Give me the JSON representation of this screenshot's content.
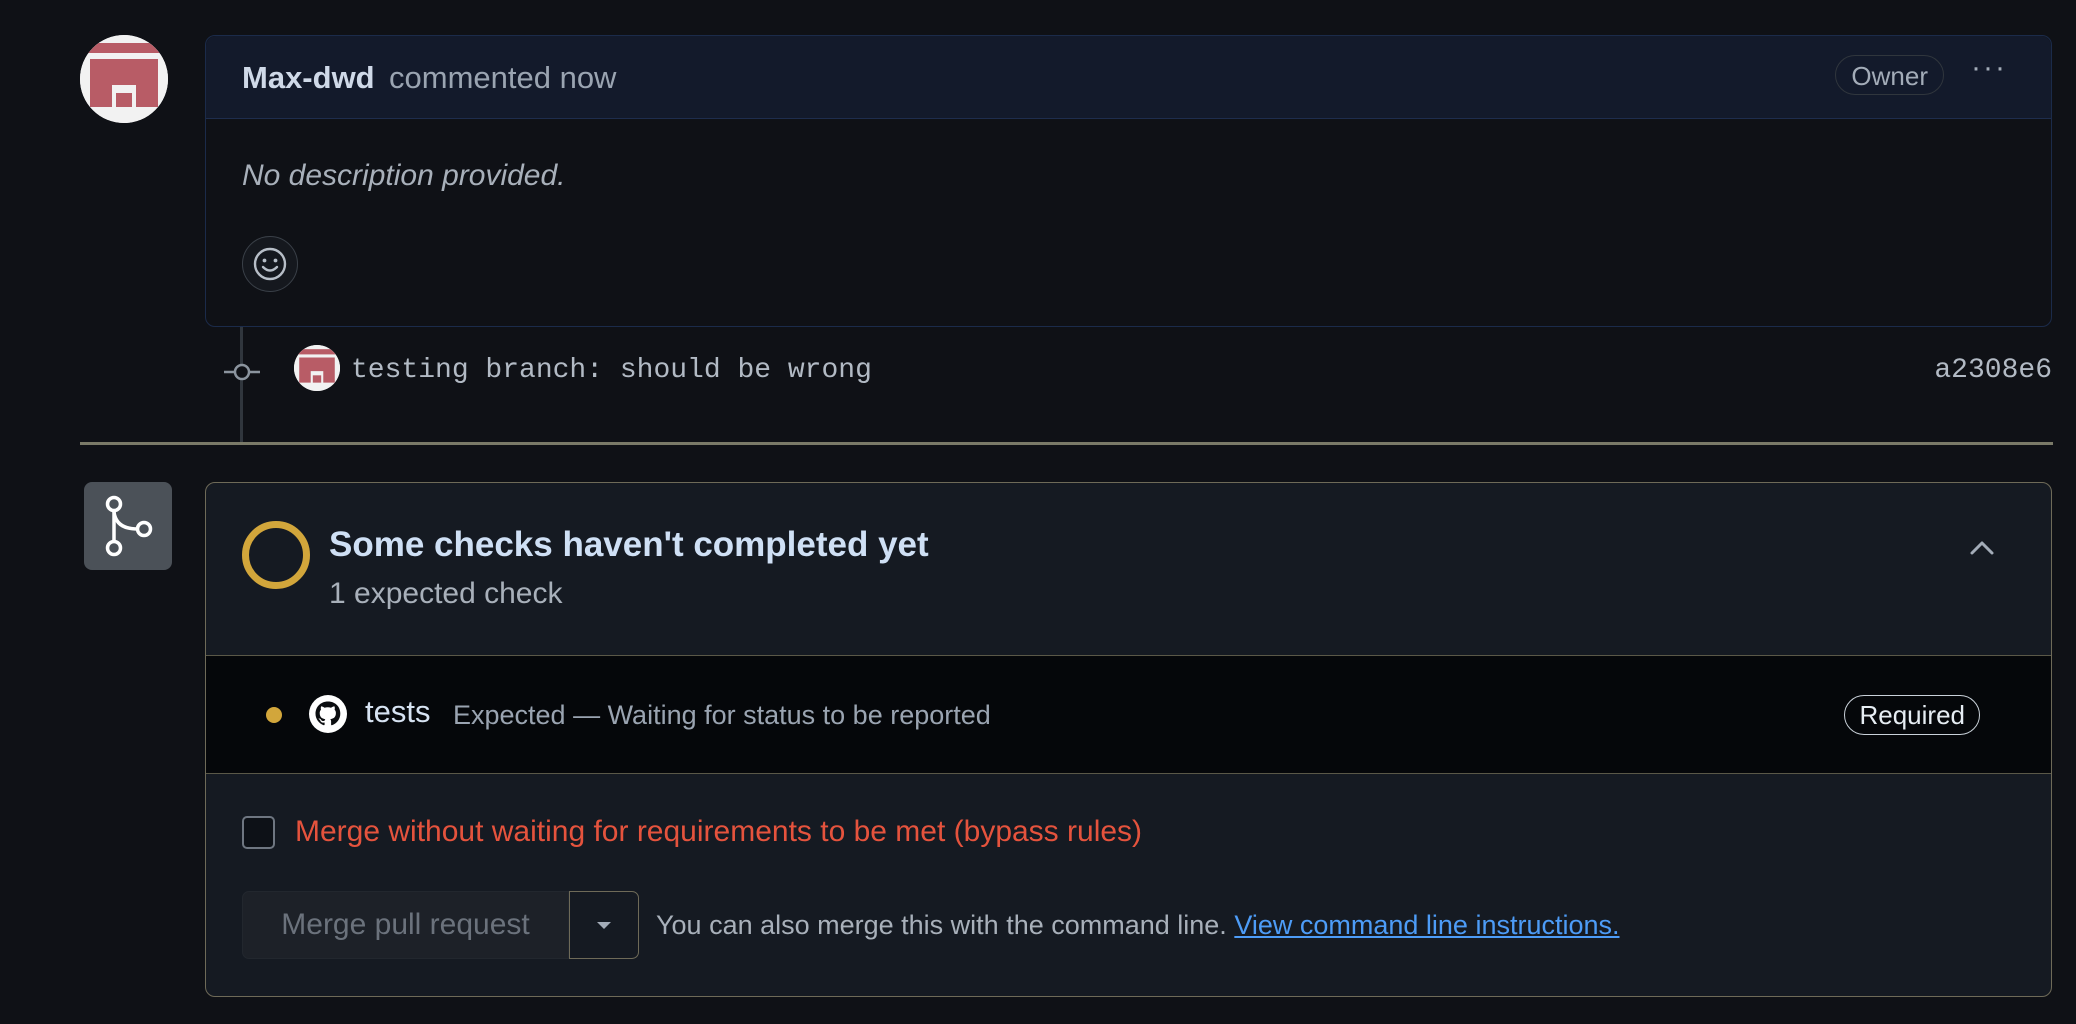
{
  "comment": {
    "author": "Max-dwd",
    "action": "commented now",
    "badge": "Owner",
    "menu_label": "···",
    "body": "No description provided."
  },
  "commit": {
    "message": "testing branch: should be wrong",
    "sha": "a2308e6"
  },
  "checks": {
    "title": "Some checks haven't completed yet",
    "subtitle": "1 expected check",
    "items": [
      {
        "name": "tests",
        "description": "Expected — Waiting for status to be reported",
        "badge": "Required"
      }
    ]
  },
  "merge": {
    "bypass_label": "Merge without waiting for requirements to be met (bypass rules)",
    "button_label": "Merge pull request",
    "cli_text": "You can also merge this with the command line.",
    "cli_link": "View command line instructions."
  },
  "colors": {
    "pending": "#d2a63b",
    "danger": "#e5533d",
    "link": "#4d9cf7",
    "avatar_red": "#b85c66"
  },
  "icons": [
    "avatar",
    "kebab-icon",
    "smiley-icon",
    "commit-icon",
    "git-merge-icon",
    "pending-circle-icon",
    "chevron-up-icon",
    "github-icon",
    "caret-down-icon"
  ]
}
